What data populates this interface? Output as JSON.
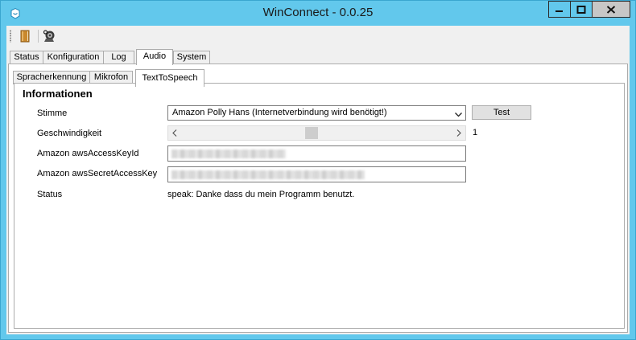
{
  "window": {
    "title": "WinConnect - 0.0.25",
    "app_icon": "winconnect-app-icon",
    "controls": [
      "minimize-icon",
      "maximize-icon",
      "close-icon"
    ]
  },
  "toolbar": {
    "buttons": [
      "book-icon",
      "webcam-settings-icon"
    ]
  },
  "tabs": [
    "Status",
    "Konfiguration",
    "Log",
    "Audio",
    "System"
  ],
  "active_tab": "Audio",
  "subtabs": [
    "Spracherkennung",
    "Mikrofon",
    "TextToSpeech"
  ],
  "active_subtab": "TextToSpeech",
  "group": {
    "title": "Informationen"
  },
  "form": {
    "voice_label": "Stimme",
    "voice_value": "Amazon Polly Hans (Internetverbindung wird benötigt!)",
    "test_button": "Test",
    "speed_label": "Geschwindigkeit",
    "speed_value": "1",
    "speed_slider_level": 0.48,
    "access_key_label": "Amazon awsAccessKeyId",
    "secret_key_label": "Amazon awsSecretAccessKey",
    "status_label": "Status",
    "status_value": "speak: Danke dass du mein Programm benutzt."
  },
  "colors": {
    "title_bar": "#62c8ec",
    "window_background": "#f0f0f0",
    "close_button": "#c7c7c7"
  }
}
